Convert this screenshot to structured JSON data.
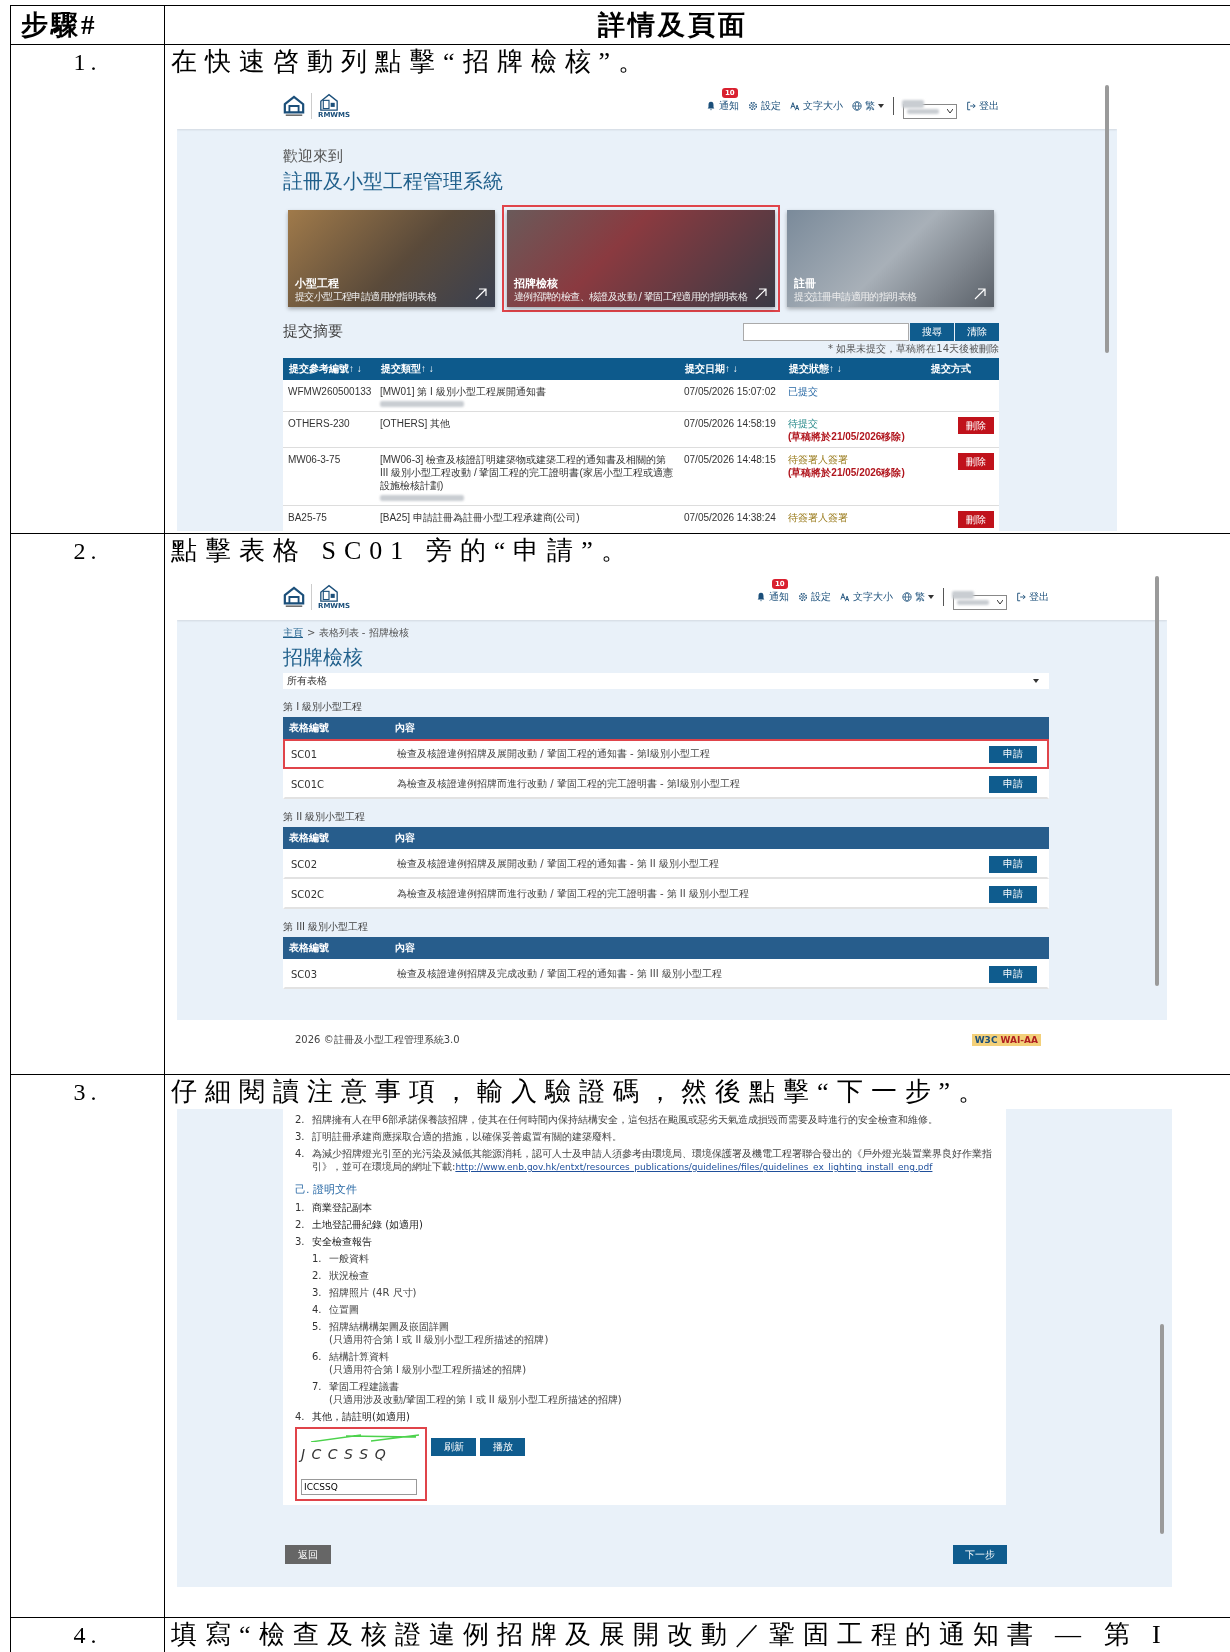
{
  "table": {
    "columns": [
      "步驟#",
      "詳情及頁面"
    ],
    "steps": [
      {
        "number": "1.",
        "instruction": "在快速啓動列點擊“招牌檢核”。",
        "screenshot": {
          "kind": "home",
          "header": {
            "logo_text": "RMWMS",
            "links": [
              {
                "kind": "notifications",
                "label": "通知",
                "badge": "10"
              },
              {
                "kind": "settings",
                "label": "設定"
              },
              {
                "kind": "text_size",
                "label": "文字大小"
              },
              {
                "kind": "language",
                "label": "繁"
              }
            ],
            "user_select": {
              "redacted": true
            },
            "logout": "登出"
          },
          "welcome": "歡迎來到",
          "system_title": "註冊及小型工程管理系統",
          "cards": [
            {
              "title": "小型工程",
              "subtitle": "提交小型工程申請適用的指明表格",
              "highlighted": false
            },
            {
              "title": "招牌檢核",
              "subtitle": "違例招牌的檢查、核證及改動 / 鞏固工程適用的指明表格",
              "highlighted": true
            },
            {
              "title": "註冊",
              "subtitle": "提交註冊申請適用的指明表格",
              "highlighted": false
            }
          ],
          "summary": {
            "title": "提交摘要",
            "search_button": "搜尋",
            "clear_button": "清除",
            "note": "* 如果未提交，草稿將在14天後被刪除",
            "columns": [
              {
                "label": "提交參考編號",
                "sort": "↑ ↓"
              },
              {
                "label": "提交類型",
                "sort": "↑ ↓"
              },
              {
                "label": "提交日期",
                "sort": "↑ ↓"
              },
              {
                "label": "提交狀態",
                "sort": "↑ ↓"
              },
              {
                "label": "提交方式"
              }
            ],
            "rows": [
              {
                "reference": "WFMW260500133",
                "type": "[MW01] 第 I 級別小型工程展開通知書",
                "redacted": true,
                "date": "07/05/2026 15:07:02",
                "status": "已提交",
                "kind": "submitted"
              },
              {
                "reference": "OTHERS-230",
                "type": "[OTHERS] 其他",
                "redacted": false,
                "date": "07/05/2026 14:58:19",
                "status": "待提交",
                "kind": "pending",
                "status_note": "(草稿將於21/05/2026移除)",
                "action": "刪除"
              },
              {
                "reference": "MW06-3-75",
                "type": "[MW06-3] 檢查及核證訂明建築物或建築工程的通知書及相關的第 III 級別小型工程改動 / 鞏固工程的完工證明書(家居小型工程或適憲設施檢核計劃)",
                "redacted": true,
                "date": "07/05/2026 14:48:15",
                "status": "待簽署人簽署",
                "kind": "signing",
                "status_note": "(草稿將於21/05/2026移除)",
                "action": "刪除"
              },
              {
                "reference": "BA25-75",
                "type": "[BA25] 申請註冊為註冊小型工程承建商(公司)",
                "redacted": false,
                "date": "07/05/2026 14:38:24",
                "status": "待簽署人簽署",
                "kind": "signing",
                "action": "刪除"
              }
            ]
          }
        }
      },
      {
        "number": "2.",
        "instruction": "點擊表格 SC01 旁的“申請”。",
        "screenshot": {
          "kind": "form_list",
          "header": {
            "logo_text": "RMWMS",
            "links": [
              {
                "kind": "notifications",
                "label": "通知",
                "badge": "10"
              },
              {
                "kind": "settings",
                "label": "設定"
              },
              {
                "kind": "text_size",
                "label": "文字大小"
              },
              {
                "kind": "language",
                "label": "繁"
              }
            ],
            "user_select": {
              "redacted": true
            },
            "logout": "登出"
          },
          "breadcrumb": {
            "link": "主頁",
            "rest": "> 表格列表 - 招牌檢核"
          },
          "title": "招牌檢核",
          "filter": "所有表格",
          "groups": [
            {
              "heading": "第 I 級別小型工程",
              "columns": [
                "表格編號",
                "內容"
              ],
              "rows": [
                {
                  "code": "SC01",
                  "content": "檢查及核證違例招牌及展開改動 / 鞏固工程的通知書 - 第I級別小型工程",
                  "button": "申請",
                  "highlighted": true
                },
                {
                  "code": "SC01C",
                  "content": "為檢查及核證違例招牌而進行改動 / 鞏固工程的完工證明書 - 第I級別小型工程",
                  "button": "申請",
                  "highlighted": false
                }
              ]
            },
            {
              "heading": "第 II 級別小型工程",
              "columns": [
                "表格編號",
                "內容"
              ],
              "rows": [
                {
                  "code": "SC02",
                  "content": "檢查及核證違例招牌及展開改動 / 鞏固工程的通知書 - 第 II 級別小型工程",
                  "button": "申請",
                  "highlighted": false
                },
                {
                  "code": "SC02C",
                  "content": "為檢查及核證違例招牌而進行改動 / 鞏固工程的完工證明書 - 第 II 級別小型工程",
                  "button": "申請",
                  "highlighted": false
                }
              ]
            },
            {
              "heading": "第 III 級別小型工程",
              "columns": [
                "表格編號",
                "內容"
              ],
              "rows": [
                {
                  "code": "SC03",
                  "content": "檢查及核證違例招牌及完成改動 / 鞏固工程的通知書 - 第 III 級別小型工程",
                  "button": "申請",
                  "highlighted": false
                }
              ]
            }
          ],
          "footer": {
            "copyright": "2026 ©註冊及小型工程管理系統3.0",
            "badge_logo": "W3C",
            "badge": "WAI-AA"
          }
        }
      },
      {
        "number": "3.",
        "instruction": "仔細閱讀注意事項，輸入驗證碼，然後點擊“下一步”。",
        "screenshot": {
          "kind": "notes",
          "notes": [
            {
              "number": "2.",
              "text": "招牌擁有人在甲6部承諾保養該招牌，使其在任何時間內保持結構安全，這包括在颱風或惡劣天氣造成損毀而需要及時進行的安全檢查和維修。"
            },
            {
              "number": "3.",
              "text": "訂明註冊承建商應採取合適的措施，以確保妥善處置有關的建築廢料。"
            },
            {
              "number": "4.",
              "text": "為減少招牌燈光引至的光污染及減低其能源消耗，認可人士及申請人須參考由環境局、環境保護署及機電工程署聯合發出的《戶外燈光裝置業界良好作業指引》，並可在環境局的網址下載:",
              "link": "http://www.enb.gov.hk/entxt/resources_publications/guidelines/files/guidelines_ex_lighting_install_eng.pdf"
            }
          ],
          "section_title": "己. 證明文件",
          "documents": [
            {
              "number": "1.",
              "text": "商業登記副本"
            },
            {
              "number": "2.",
              "text": "土地登記冊紀錄 (如適用)"
            },
            {
              "number": "3.",
              "text": "安全檢查報告",
              "children": [
                {
                  "number": "1.",
                  "text": "一般資料"
                },
                {
                  "number": "2.",
                  "text": "狀況檢查"
                },
                {
                  "number": "3.",
                  "text": "招牌照片 (4R 尺寸)"
                },
                {
                  "number": "4.",
                  "text": "位置圖"
                },
                {
                  "number": "5.",
                  "text": "招牌結構構架圖及嵌固詳圖",
                  "note": "(只適用符合第 I 或 II 級別小型工程所描述的招牌)"
                },
                {
                  "number": "6.",
                  "text": "結構計算資料",
                  "note": "(只適用符合第 I 級別小型工程所描述的招牌)"
                },
                {
                  "number": "7.",
                  "text": "鞏固工程建議書",
                  "note": "(只適用涉及改動/鞏固工程的第 I 或 II 級別小型工程所描述的招牌)"
                }
              ]
            },
            {
              "number": "4.",
              "text": "其他，請註明(如適用)"
            }
          ],
          "captcha": {
            "image_text": "J C C S S Q",
            "value": "ICCSSQ",
            "highlighted": true,
            "buttons": [
              "刷新",
              "播放"
            ]
          },
          "back_button": "返回",
          "next_button": "下一步"
        }
      },
      {
        "number": "4.",
        "instruction": "填寫“檢查及核證違例招牌及展開改動／鞏固工程的通知書 — 第 I"
      }
    ]
  }
}
